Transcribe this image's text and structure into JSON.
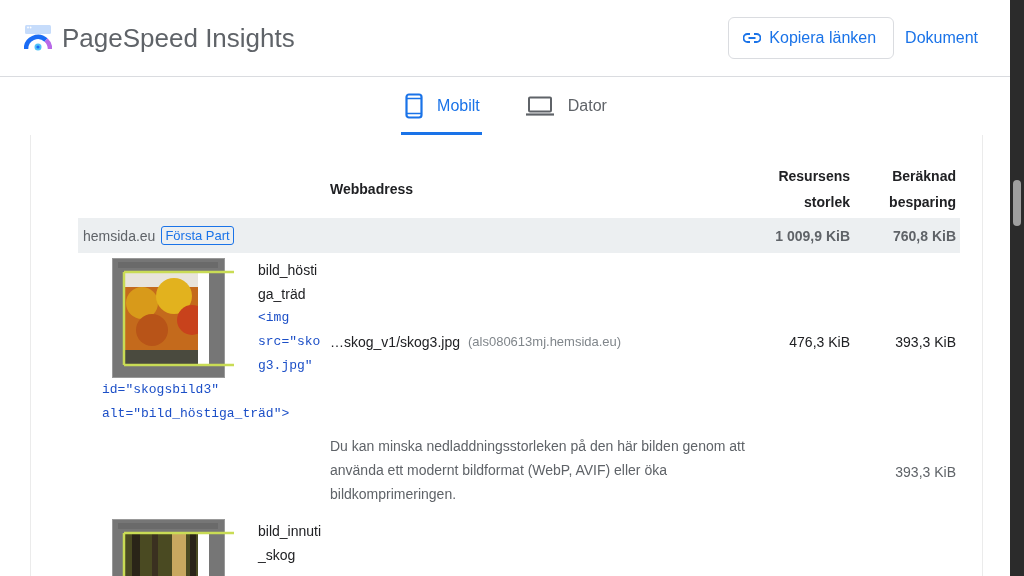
{
  "app": {
    "title": "PageSpeed Insights"
  },
  "header_actions": [
    {
      "kind": "button",
      "label": "Kopiera länken"
    },
    {
      "kind": "link",
      "label": "Dokument"
    }
  ],
  "tabs": [
    {
      "kind": "phone",
      "label": "Mobilt",
      "selected": true
    },
    {
      "kind": "laptop",
      "label": "Dator",
      "selected": false
    }
  ],
  "table": {
    "columns": [
      "Webbadress",
      "Resursens storlek",
      "Beräknad besparing"
    ],
    "group": {
      "domain": "hemsida.eu",
      "badge": "Första Part",
      "size": "1 009,9 KiB",
      "saving": "760,8 KiB"
    },
    "rows": [
      {
        "kind": "autumn",
        "node_label": "bild_höstiga_träd",
        "snippet_start": "<img src=\"skog3.jpg\"",
        "snippet_end": "id=\"skogsbild3\" alt=\"bild_höstiga_träd\">",
        "url": "…skog_v1/skog3.jpg",
        "host": "(als080613mj.hemsida.eu)",
        "size": "476,3 KiB",
        "saving": "393,3 KiB",
        "note": "Du kan minska nedladdningsstorleken på den här bilden genom att använda ett modernt bildformat (WebP, AVIF) eller öka bildkomprimeringen.",
        "note_saving": "393,3 KiB"
      },
      {
        "kind": "forest",
        "node_label": "bild_innuti_skog"
      }
    ]
  }
}
